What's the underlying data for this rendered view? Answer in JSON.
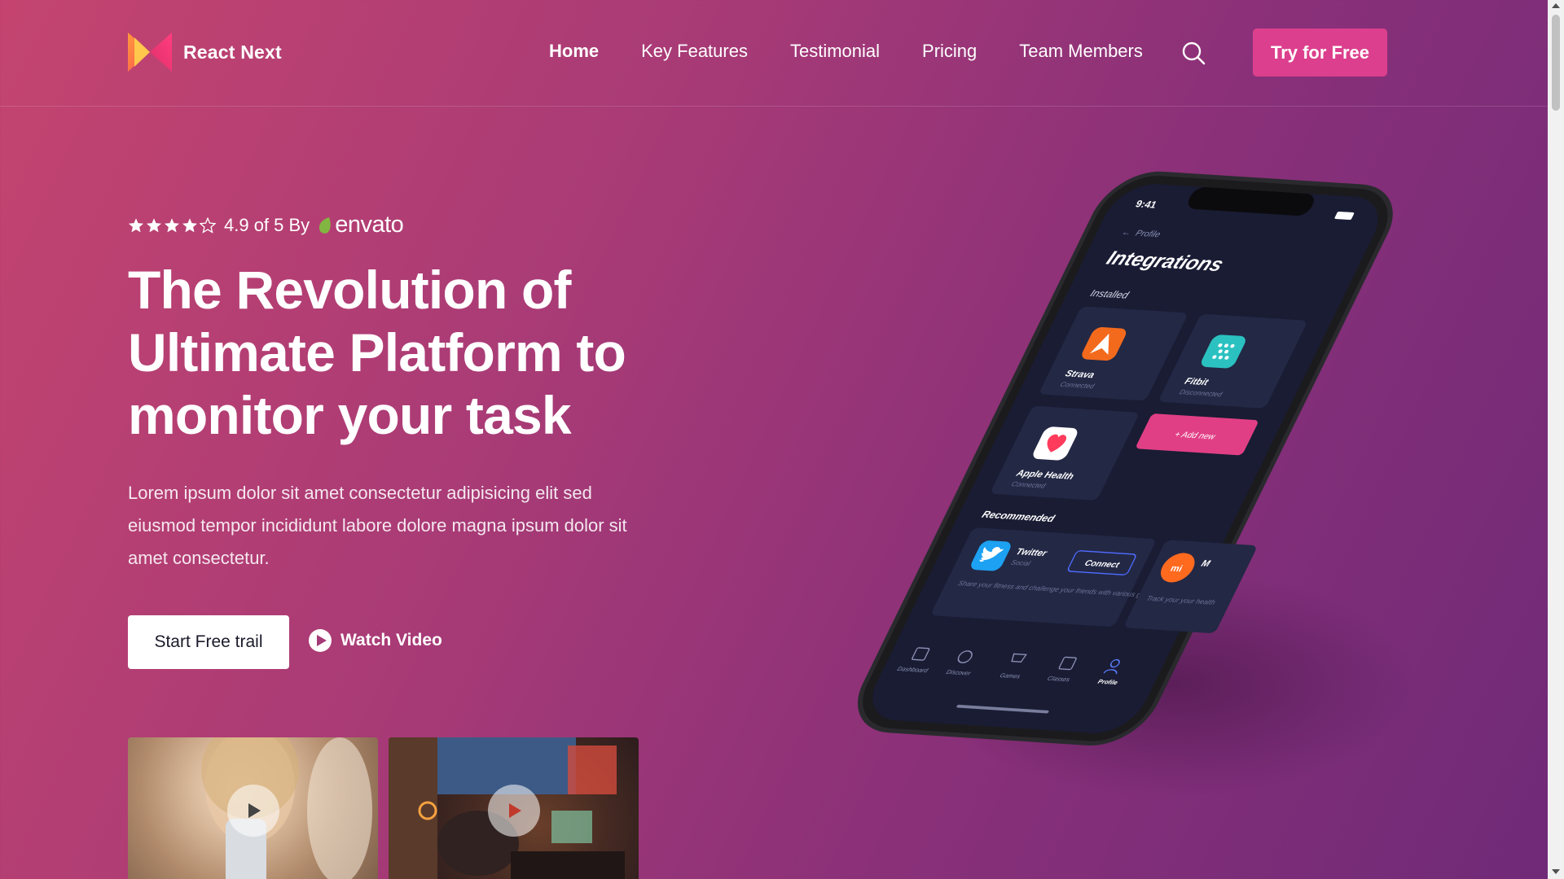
{
  "brand": {
    "name": "React Next"
  },
  "nav": {
    "items": [
      "Home",
      "Key Features",
      "Testimonial",
      "Pricing",
      "Team Members"
    ],
    "active": "Home",
    "cta_label": "Try for Free"
  },
  "hero": {
    "rating_text": "4.9 of 5 By",
    "rating_value": 4.9,
    "rating_max": 5,
    "envato_label": "envato",
    "title": "The Revolution of Ultimate Platform to monitor your task",
    "description": "Lorem ipsum dolor sit amet consectetur adipisicing elit sed eiusmod tempor incididunt labore dolore magna ipsum dolor sit amet consectetur.",
    "primary_button": "Start Free trail",
    "video_button": "Watch Video"
  },
  "phone": {
    "time": "9:41",
    "back_label": "Profile",
    "screen_title": "Integrations",
    "installed_label": "Installed",
    "installed": [
      {
        "name": "Strava",
        "status": "Connected"
      },
      {
        "name": "Fitbit",
        "status": "Disconnected"
      },
      {
        "name": "Apple Health",
        "status": "Connected"
      }
    ],
    "add_new_label": "+ Add new",
    "recommended_label": "Recommended",
    "recommended": [
      {
        "name": "Twitter",
        "category": "Social",
        "description": "Share your fitness and challenge your friends with various goals.",
        "button": "Connect"
      },
      {
        "name": "M",
        "description": "Track your your health"
      }
    ],
    "tabs": [
      "Dashboard",
      "Discover",
      "Games",
      "Classes",
      "Profile"
    ],
    "active_tab": "Profile"
  },
  "colors": {
    "accent": "#dc3f8d",
    "bg_start": "#c4446f",
    "bg_end": "#6f2a78",
    "envato_green": "#82b541"
  }
}
